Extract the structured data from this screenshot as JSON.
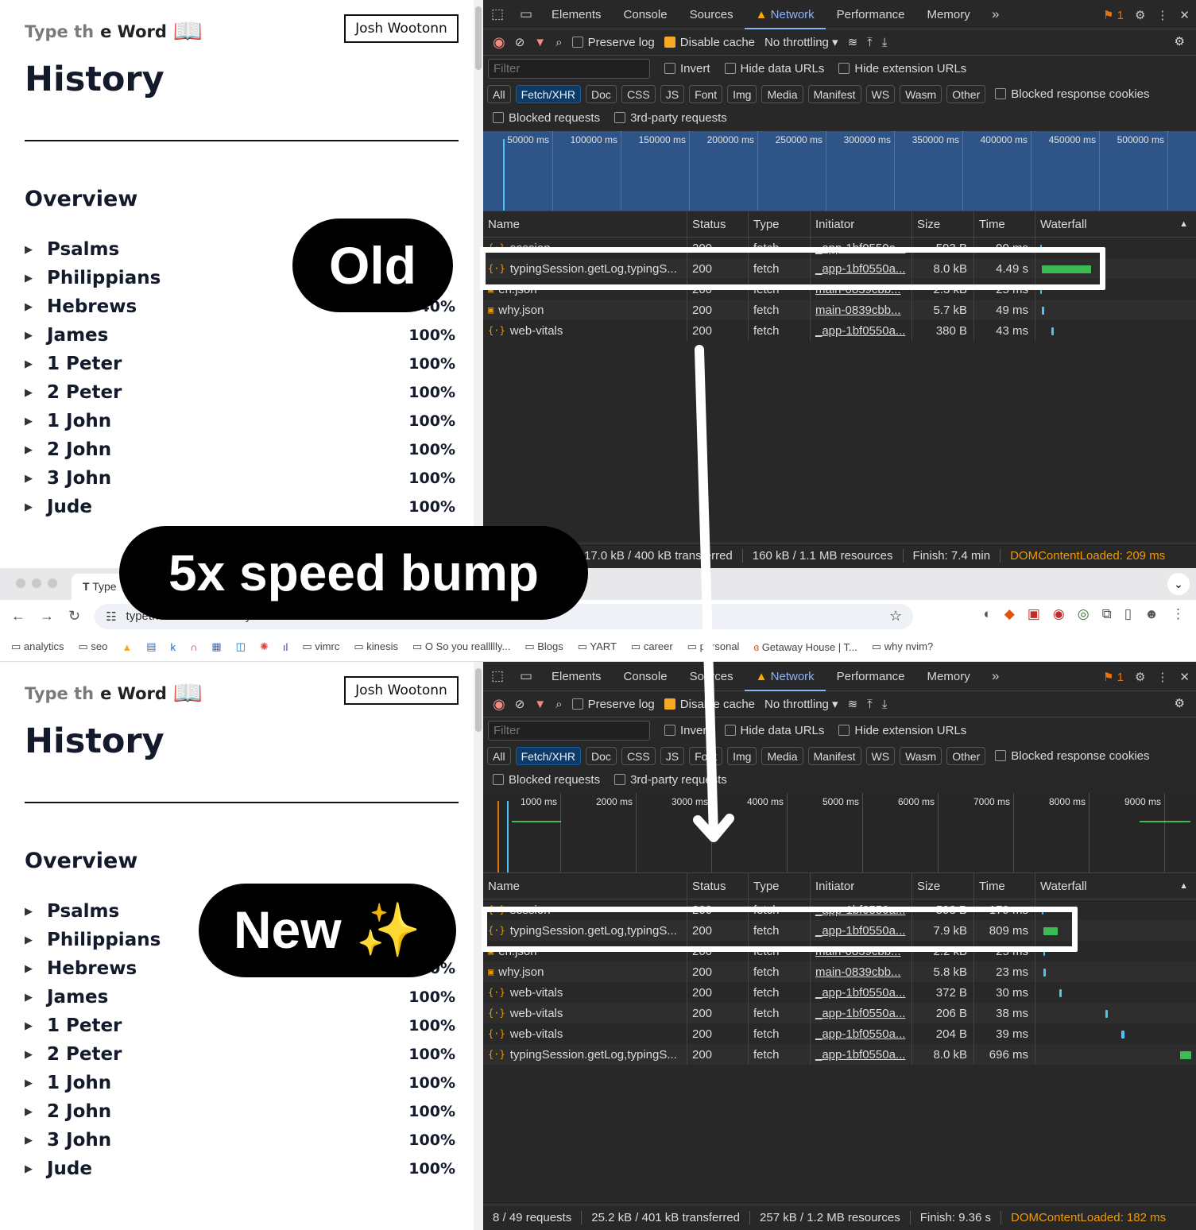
{
  "site": {
    "brand_left": "Type th",
    "brand_right": "e Word",
    "user_button": "Josh Wootonn",
    "page_title": "History",
    "section_title": "Overview"
  },
  "old_books": [
    {
      "name": "Psalms",
      "pct": ""
    },
    {
      "name": "Philippians",
      "pct": ""
    },
    {
      "name": "Hebrews",
      "pct": "40%"
    },
    {
      "name": "James",
      "pct": "100%"
    },
    {
      "name": "1 Peter",
      "pct": "100%"
    },
    {
      "name": "2 Peter",
      "pct": "100%"
    },
    {
      "name": "1 John",
      "pct": "100%"
    },
    {
      "name": "2 John",
      "pct": "100%"
    },
    {
      "name": "3 John",
      "pct": "100%"
    },
    {
      "name": "Jude",
      "pct": "100%"
    }
  ],
  "new_books": [
    {
      "name": "Psalms",
      "pct": ""
    },
    {
      "name": "Philippians",
      "pct": ""
    },
    {
      "name": "Hebrews",
      "pct": "0%"
    },
    {
      "name": "James",
      "pct": "100%"
    },
    {
      "name": "1 Peter",
      "pct": "100%"
    },
    {
      "name": "2 Peter",
      "pct": "100%"
    },
    {
      "name": "1 John",
      "pct": "100%"
    },
    {
      "name": "2 John",
      "pct": "100%"
    },
    {
      "name": "3 John",
      "pct": "100%"
    },
    {
      "name": "Jude",
      "pct": "100%"
    }
  ],
  "devtools": {
    "tabs": [
      "Elements",
      "Console",
      "Sources",
      "Network",
      "Performance",
      "Memory"
    ],
    "active_tab": "Network",
    "issues_count": "1",
    "preserve_log": "Preserve log",
    "disable_cache": "Disable cache",
    "throttling": "No throttling",
    "filter_placeholder": "Filter",
    "invert": "Invert",
    "hide_data_urls": "Hide data URLs",
    "hide_extension_urls": "Hide extension URLs",
    "type_filters": [
      "All",
      "Fetch/XHR",
      "Doc",
      "CSS",
      "JS",
      "Font",
      "Img",
      "Media",
      "Manifest",
      "WS",
      "Wasm",
      "Other"
    ],
    "active_filter": "Fetch/XHR",
    "blocked_cookies": "Blocked response cookies",
    "blocked_requests": "Blocked requests",
    "third_party": "3rd-party requests",
    "columns": [
      "Name",
      "Status",
      "Type",
      "Initiator",
      "Size",
      "Time",
      "Waterfall"
    ]
  },
  "old_network": {
    "ticks": [
      "50000 ms",
      "100000 ms",
      "150000 ms",
      "200000 ms",
      "250000 ms",
      "300000 ms",
      "350000 ms",
      "400000 ms",
      "450000 ms",
      "500000 ms",
      "55"
    ],
    "rows": [
      {
        "name": "session",
        "status": "200",
        "type": "fetch",
        "initiator": "_app-1bf0550a...",
        "size": "593 B",
        "time": "90 ms",
        "icon": "fetch"
      },
      {
        "name": "typingSession.getLog,typingS...",
        "status": "200",
        "type": "fetch",
        "initiator": "_app-1bf0550a...",
        "size": "8.0 kB",
        "time": "4.49 s",
        "icon": "fetch"
      },
      {
        "name": "en.json",
        "status": "200",
        "type": "fetch",
        "initiator": "main-0839cbb...",
        "size": "2.3 kB",
        "time": "25 ms",
        "icon": "json"
      },
      {
        "name": "why.json",
        "status": "200",
        "type": "fetch",
        "initiator": "main-0839cbb...",
        "size": "5.7 kB",
        "time": "49 ms",
        "icon": "json"
      },
      {
        "name": "web-vitals",
        "status": "200",
        "type": "fetch",
        "initiator": "_app-1bf0550a...",
        "size": "380 B",
        "time": "43 ms",
        "icon": "fetch"
      }
    ],
    "status_bar": {
      "requests": "",
      "transferred": "17.0 kB / 400 kB transferred",
      "resources": "160 kB / 1.1 MB resources",
      "finish": "Finish: 7.4 min",
      "dcl": "DOMContentLoaded: 209 ms"
    }
  },
  "new_network": {
    "ticks": [
      "1000 ms",
      "2000 ms",
      "3000 ms",
      "4000 ms",
      "5000 ms",
      "6000 ms",
      "7000 ms",
      "8000 ms",
      "9000 ms"
    ],
    "rows": [
      {
        "name": "session",
        "status": "200",
        "type": "fetch",
        "initiator": "_app-1bf0550a...",
        "size": "593 B",
        "time": "179 ms",
        "icon": "fetch"
      },
      {
        "name": "typingSession.getLog,typingS...",
        "status": "200",
        "type": "fetch",
        "initiator": "_app-1bf0550a...",
        "size": "7.9 kB",
        "time": "809 ms",
        "icon": "fetch"
      },
      {
        "name": "en.json",
        "status": "200",
        "type": "fetch",
        "initiator": "main-0839cbb...",
        "size": "2.2 kB",
        "time": "25 ms",
        "icon": "json"
      },
      {
        "name": "why.json",
        "status": "200",
        "type": "fetch",
        "initiator": "main-0839cbb...",
        "size": "5.8 kB",
        "time": "23 ms",
        "icon": "json"
      },
      {
        "name": "web-vitals",
        "status": "200",
        "type": "fetch",
        "initiator": "_app-1bf0550a...",
        "size": "372 B",
        "time": "30 ms",
        "icon": "fetch"
      },
      {
        "name": "web-vitals",
        "status": "200",
        "type": "fetch",
        "initiator": "_app-1bf0550a...",
        "size": "206 B",
        "time": "38 ms",
        "icon": "fetch"
      },
      {
        "name": "web-vitals",
        "status": "200",
        "type": "fetch",
        "initiator": "_app-1bf0550a...",
        "size": "204 B",
        "time": "39 ms",
        "icon": "fetch"
      },
      {
        "name": "typingSession.getLog,typingS...",
        "status": "200",
        "type": "fetch",
        "initiator": "_app-1bf0550a...",
        "size": "8.0 kB",
        "time": "696 ms",
        "icon": "fetch"
      }
    ],
    "status_bar": {
      "requests": "8 / 49 requests",
      "transferred": "25.2 kB / 401 kB transferred",
      "resources": "257 kB / 1.2 MB resources",
      "finish": "Finish: 9.36 s",
      "dcl": "DOMContentLoaded: 182 ms"
    }
  },
  "browser": {
    "tab_title": "Type",
    "url": "typetheword.site/history",
    "bookmarks": [
      "analytics",
      "seo",
      "vimrc",
      "kinesis",
      "O So you reallllly...",
      "Blogs",
      "YART",
      "career",
      "personal",
      "Getaway House | T...",
      "why nvim?"
    ]
  },
  "annotations": {
    "old_label": "Old",
    "new_label": "New ✨",
    "speed_label": "5x speed bump"
  }
}
